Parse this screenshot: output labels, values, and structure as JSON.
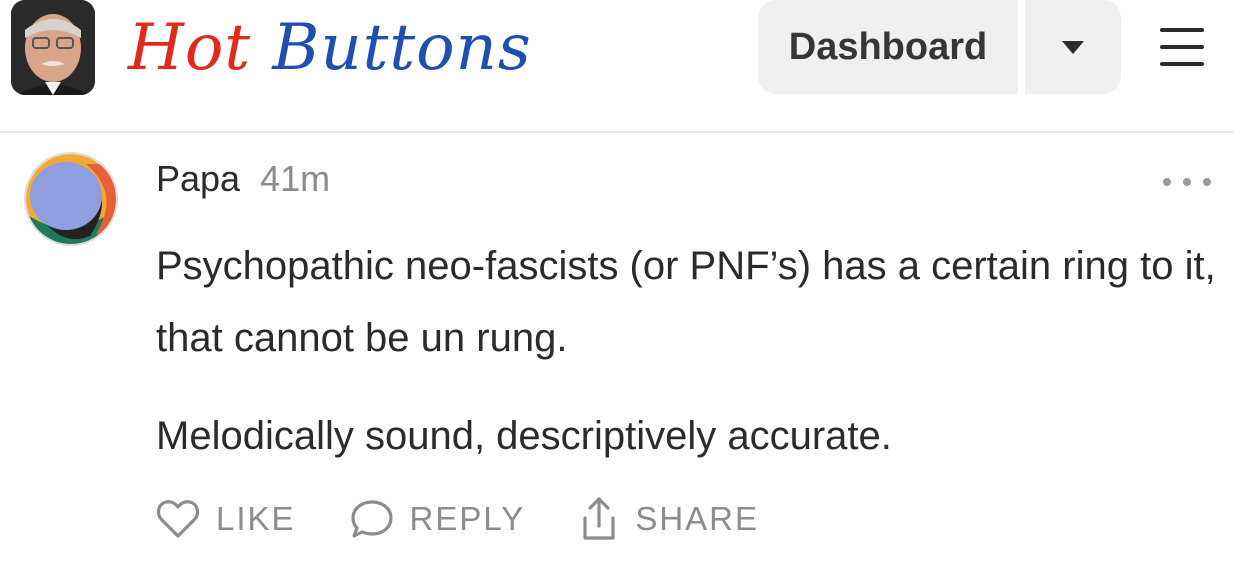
{
  "header": {
    "publication_title_part1": "Hot",
    "publication_title_part2": "Buttons",
    "dashboard_label": "Dashboard",
    "dashboard_menu_icon": "caret-down-icon",
    "menu_icon": "hamburger-menu-icon"
  },
  "comment": {
    "author": "Papa",
    "timestamp": "41m",
    "more_icon": "more-horizontal-icon",
    "paragraphs": [
      "Psychopathic neo-fascists (or PNF’s) has a certain ring to it, that cannot be un rung.",
      "Melodically sound, descriptively accurate."
    ],
    "actions": {
      "like_label": "LIKE",
      "reply_label": "REPLY",
      "share_label": "SHARE"
    }
  },
  "colors": {
    "title_hot": "#e02a1b",
    "title_buttons": "#1f4fb0",
    "muted_text": "#8c8c8c",
    "button_bg": "#f0f0f0"
  }
}
